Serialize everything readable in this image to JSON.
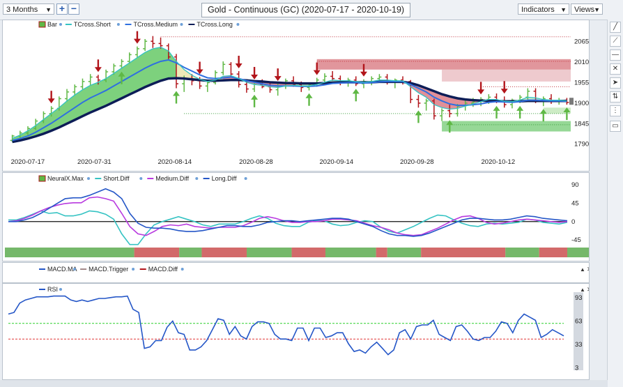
{
  "toolbar": {
    "range_select": "3 Months",
    "zoom_in": "+",
    "zoom_out": "−",
    "title": "Gold - Continuous (GC) (2020-07-17 - 2020-10-19)",
    "indicators_label": "Indicators",
    "views_label": "Views"
  },
  "side_tools": [
    "line-tool-icon",
    "trend-tool-icon",
    "horizontal-line-icon",
    "cross-icon",
    "pointer-icon",
    "measure-icon",
    "menu-dots-icon",
    "comment-icon"
  ],
  "colors": {
    "up": "#5fb845",
    "down": "#b2151b",
    "short": "#35c3c3",
    "medium": "#2f6fe0",
    "long": "#0d1d57",
    "magenta": "#b83adf",
    "rsi": "#2456c7",
    "green_line": "#2bd02b",
    "red_line": "#e03434"
  },
  "chart_data": [
    {
      "type": "line",
      "pane": "price",
      "legend": [
        "Bar",
        "TCross.Short",
        "TCross.Medium",
        "TCross.Long"
      ],
      "x_ticks": [
        "2020-07-17",
        "2020-07-31",
        "2020-08-14",
        "2020-08-28",
        "2020-09-14",
        "2020-09-28",
        "2020-10-12"
      ],
      "y_ticks": [
        2065,
        2010,
        1955,
        1900,
        1845,
        1790
      ],
      "ylim": [
        1782,
        2100
      ],
      "last_value": "1900.00",
      "bars": [
        [
          1800,
          1815,
          1796,
          1812
        ],
        [
          1812,
          1826,
          1806,
          1820
        ],
        [
          1820,
          1838,
          1814,
          1832
        ],
        [
          1832,
          1858,
          1828,
          1852
        ],
        [
          1852,
          1878,
          1846,
          1872
        ],
        [
          1872,
          1892,
          1864,
          1886
        ],
        [
          1886,
          1918,
          1880,
          1912
        ],
        [
          1912,
          1938,
          1904,
          1930
        ],
        [
          1930,
          1950,
          1920,
          1944
        ],
        [
          1944,
          1966,
          1936,
          1958
        ],
        [
          1958,
          1978,
          1948,
          1970
        ],
        [
          1970,
          1976,
          1950,
          1962
        ],
        [
          1962,
          1990,
          1956,
          1984
        ],
        [
          1984,
          2006,
          1976,
          2000
        ],
        [
          2000,
          2018,
          1992,
          2012
        ],
        [
          2012,
          2036,
          2006,
          2030
        ],
        [
          2030,
          2052,
          2022,
          2046
        ],
        [
          2046,
          2072,
          2040,
          2066
        ],
        [
          2066,
          2080,
          2048,
          2060
        ],
        [
          2060,
          2076,
          2046,
          2054
        ],
        [
          2054,
          2060,
          2018,
          2024
        ],
        [
          2024,
          2032,
          1940,
          1952
        ],
        [
          1952,
          1974,
          1930,
          1966
        ],
        [
          1966,
          1978,
          1948,
          1960
        ],
        [
          1960,
          1970,
          1938,
          1946
        ],
        [
          1946,
          1962,
          1930,
          1955
        ],
        [
          1955,
          1988,
          1950,
          1982
        ],
        [
          1982,
          2012,
          1975,
          2004
        ],
        [
          2004,
          2010,
          1972,
          1978
        ],
        [
          1978,
          1986,
          1942,
          1950
        ],
        [
          1950,
          1960,
          1928,
          1938
        ],
        [
          1938,
          1956,
          1930,
          1950
        ],
        [
          1950,
          1964,
          1940,
          1944
        ],
        [
          1944,
          1958,
          1928,
          1936
        ],
        [
          1936,
          1952,
          1920,
          1946
        ],
        [
          1946,
          1966,
          1938,
          1960
        ],
        [
          1960,
          1972,
          1944,
          1950
        ],
        [
          1950,
          1958,
          1930,
          1942
        ],
        [
          1942,
          1956,
          1934,
          1950
        ],
        [
          1950,
          1968,
          1944,
          1962
        ],
        [
          1962,
          1980,
          1954,
          1972
        ],
        [
          1972,
          1986,
          1960,
          1966
        ],
        [
          1966,
          1974,
          1948,
          1956
        ],
        [
          1956,
          1968,
          1944,
          1962
        ],
        [
          1962,
          1972,
          1946,
          1952
        ],
        [
          1952,
          1964,
          1940,
          1958
        ],
        [
          1958,
          1972,
          1948,
          1966
        ],
        [
          1966,
          1978,
          1956,
          1970
        ],
        [
          1970,
          1978,
          1950,
          1958
        ],
        [
          1958,
          1966,
          1940,
          1962
        ],
        [
          1962,
          1972,
          1950,
          1958
        ],
        [
          1958,
          1962,
          1900,
          1910
        ],
        [
          1910,
          1922,
          1888,
          1900
        ],
        [
          1900,
          1912,
          1880,
          1906
        ],
        [
          1906,
          1912,
          1856,
          1866
        ],
        [
          1866,
          1886,
          1852,
          1880
        ],
        [
          1880,
          1896,
          1862,
          1872
        ],
        [
          1872,
          1898,
          1864,
          1892
        ],
        [
          1892,
          1908,
          1880,
          1900
        ],
        [
          1900,
          1914,
          1890,
          1904
        ],
        [
          1904,
          1916,
          1892,
          1910
        ],
        [
          1910,
          1924,
          1898,
          1916
        ],
        [
          1916,
          1926,
          1900,
          1906
        ],
        [
          1906,
          1918,
          1888,
          1896
        ],
        [
          1896,
          1912,
          1886,
          1908
        ],
        [
          1908,
          1922,
          1900,
          1916
        ],
        [
          1916,
          1940,
          1910,
          1932
        ],
        [
          1932,
          1940,
          1900,
          1906
        ],
        [
          1906,
          1918,
          1892,
          1912
        ],
        [
          1912,
          1924,
          1898,
          1904
        ],
        [
          1904,
          1914,
          1896,
          1908
        ],
        [
          1908,
          1914,
          1896,
          1902
        ]
      ],
      "series": [
        {
          "name": "TCross.Short",
          "values": [
            1806,
            1814,
            1826,
            1840,
            1856,
            1872,
            1888,
            1906,
            1922,
            1936,
            1948,
            1956,
            1966,
            1980,
            1994,
            2008,
            2022,
            2036,
            2046,
            2050,
            2040,
            2012,
            1990,
            1975,
            1964,
            1958,
            1962,
            1972,
            1974,
            1966,
            1956,
            1950,
            1948,
            1944,
            1942,
            1946,
            1948,
            1946,
            1946,
            1950,
            1956,
            1962,
            1960,
            1960,
            1958,
            1956,
            1958,
            1962,
            1962,
            1960,
            1960,
            1944,
            1928,
            1916,
            1896,
            1888,
            1884,
            1886,
            1892,
            1898,
            1904,
            1910,
            1910,
            1905,
            1904,
            1908,
            1916,
            1914,
            1910,
            1908,
            1908,
            1906
          ]
        },
        {
          "name": "TCross.Medium",
          "values": [
            1800,
            1805,
            1812,
            1822,
            1834,
            1846,
            1860,
            1874,
            1888,
            1902,
            1914,
            1924,
            1934,
            1946,
            1958,
            1970,
            1982,
            1994,
            2004,
            2012,
            2016,
            2008,
            1996,
            1986,
            1976,
            1968,
            1966,
            1968,
            1970,
            1966,
            1960,
            1956,
            1952,
            1948,
            1946,
            1946,
            1946,
            1945,
            1945,
            1946,
            1949,
            1953,
            1954,
            1955,
            1955,
            1954,
            1955,
            1957,
            1958,
            1958,
            1958,
            1950,
            1940,
            1930,
            1916,
            1906,
            1898,
            1894,
            1894,
            1896,
            1898,
            1902,
            1904,
            1903,
            1902,
            1904,
            1908,
            1908,
            1907,
            1906,
            1906,
            1905
          ]
        },
        {
          "name": "TCross.Long",
          "values": [
            1796,
            1800,
            1805,
            1811,
            1818,
            1826,
            1835,
            1845,
            1855,
            1865,
            1875,
            1884,
            1893,
            1903,
            1913,
            1923,
            1933,
            1943,
            1952,
            1960,
            1966,
            1967,
            1966,
            1964,
            1962,
            1960,
            1960,
            1961,
            1962,
            1962,
            1961,
            1959,
            1958,
            1956,
            1955,
            1954,
            1954,
            1953,
            1953,
            1953,
            1954,
            1955,
            1956,
            1956,
            1956,
            1956,
            1956,
            1957,
            1957,
            1957,
            1957,
            1954,
            1948,
            1940,
            1932,
            1924,
            1918,
            1913,
            1910,
            1908,
            1907,
            1906,
            1906,
            1905,
            1905,
            1905,
            1906,
            1906,
            1906,
            1906,
            1906,
            1906
          ]
        }
      ],
      "signals_down": [
        5,
        11,
        16,
        24,
        29,
        31,
        34,
        39,
        45,
        60,
        63
      ],
      "signals_up": [
        14,
        21,
        31,
        38,
        44,
        52,
        56,
        62,
        65,
        68,
        71
      ]
    },
    {
      "type": "line",
      "pane": "neuralx",
      "legend": [
        "NeuralX.Max",
        "Short.Diff",
        "Medium.Diff",
        "Long.Diff"
      ],
      "y_ticks": [
        90,
        45,
        0,
        -45
      ],
      "ylim": [
        -60,
        95
      ],
      "series": [
        {
          "name": "Short.Diff",
          "values": [
            4,
            4,
            10,
            18,
            26,
            20,
            22,
            14,
            14,
            18,
            26,
            24,
            18,
            6,
            -30,
            -56,
            -56,
            -30,
            -8,
            0,
            6,
            12,
            6,
            0,
            -8,
            -12,
            -6,
            -6,
            -6,
            0,
            8,
            14,
            8,
            -4,
            -10,
            -12,
            -12,
            -2,
            2,
            2,
            -6,
            -10,
            -8,
            -2,
            2,
            0,
            -14,
            -24,
            -28,
            -20,
            -12,
            -2,
            8,
            16,
            14,
            4,
            -4,
            -10,
            -12,
            -6,
            -4,
            -6,
            -4,
            -2,
            6,
            4,
            -2,
            -4,
            -6,
            -2
          ]
        },
        {
          "name": "Medium.Diff",
          "values": [
            0,
            2,
            8,
            16,
            26,
            34,
            40,
            44,
            46,
            46,
            58,
            60,
            56,
            50,
            20,
            -12,
            -30,
            -34,
            -24,
            -12,
            -8,
            -10,
            -6,
            -12,
            -14,
            -16,
            -14,
            -14,
            -14,
            -10,
            -2,
            8,
            12,
            8,
            2,
            -2,
            -2,
            0,
            0,
            2,
            6,
            6,
            4,
            2,
            -4,
            -10,
            -14,
            -20,
            -28,
            -32,
            -34,
            -32,
            -24,
            -16,
            -6,
            4,
            12,
            14,
            8,
            -2,
            -6,
            -4,
            0,
            4,
            6,
            4,
            2,
            0,
            -2,
            0
          ]
        },
        {
          "name": "Long.Diff",
          "values": [
            0,
            0,
            4,
            10,
            20,
            32,
            44,
            56,
            58,
            58,
            64,
            72,
            80,
            72,
            56,
            20,
            -4,
            -14,
            -16,
            -16,
            -18,
            -22,
            -24,
            -24,
            -22,
            -18,
            -14,
            -10,
            -10,
            -12,
            -12,
            -8,
            -2,
            0,
            2,
            2,
            0,
            2,
            4,
            6,
            8,
            8,
            6,
            0,
            -6,
            -12,
            -22,
            -30,
            -34,
            -34,
            -36,
            -34,
            -28,
            -20,
            -12,
            -4,
            4,
            8,
            8,
            6,
            4,
            4,
            6,
            10,
            14,
            12,
            8,
            6,
            4,
            2
          ]
        }
      ],
      "regime": [
        [
          "up",
          0.23
        ],
        [
          "down",
          0.08
        ],
        [
          "up",
          0.04
        ],
        [
          "down",
          0.08
        ],
        [
          "up",
          0.08
        ],
        [
          "down",
          0.06
        ],
        [
          "up",
          0.09
        ],
        [
          "down",
          0.02
        ],
        [
          "up",
          0.06
        ],
        [
          "down",
          0.15
        ],
        [
          "up",
          0.06
        ],
        [
          "down",
          0.05
        ],
        [
          "up",
          0.04
        ],
        [
          "down",
          0.03
        ],
        [
          "up",
          0.03
        ]
      ]
    },
    {
      "type": "line",
      "pane": "macd",
      "legend": [
        "MACD.MA",
        "MACD.Trigger",
        "MACD.Diff"
      ],
      "series": []
    },
    {
      "type": "line",
      "pane": "rsi",
      "legend": [
        "RSI"
      ],
      "y_ticks": [
        93,
        63,
        33,
        3
      ],
      "ylim": [
        0,
        100
      ],
      "levels": [
        60,
        40
      ],
      "series": [
        {
          "name": "RSI",
          "values": [
            72,
            74,
            86,
            90,
            92,
            94,
            94,
            94,
            95,
            95,
            95,
            90,
            88,
            90,
            88,
            90,
            92,
            92,
            93,
            94,
            94,
            95,
            78,
            74,
            28,
            30,
            38,
            38,
            55,
            63,
            48,
            46,
            26,
            26,
            30,
            38,
            52,
            66,
            64,
            46,
            56,
            44,
            40,
            56,
            62,
            62,
            60,
            46,
            40,
            40,
            38,
            54,
            54,
            38,
            54,
            54,
            42,
            44,
            48,
            48,
            34,
            24,
            26,
            22,
            30,
            36,
            28,
            20,
            26,
            48,
            52,
            40,
            56,
            58,
            58,
            64,
            46,
            42,
            38,
            56,
            58,
            50,
            40,
            38,
            42,
            42,
            50,
            62,
            60,
            48,
            64,
            72,
            68,
            64,
            42,
            46,
            52,
            48,
            44
          ]
        }
      ]
    }
  ]
}
